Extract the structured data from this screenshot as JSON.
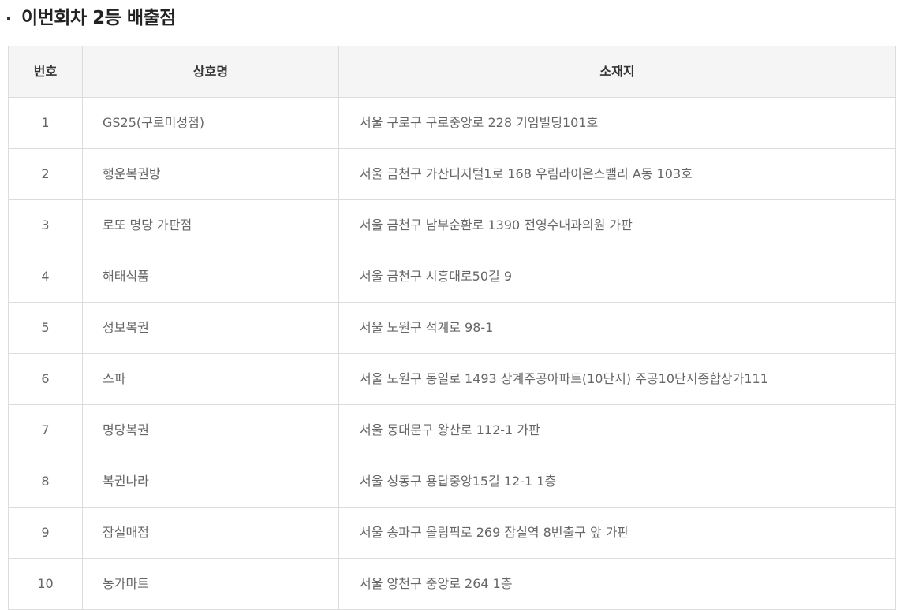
{
  "section": {
    "title": "이번회차 2등 배출점"
  },
  "table": {
    "headers": {
      "no": "번호",
      "name": "상호명",
      "address": "소재지"
    },
    "rows": [
      {
        "no": "1",
        "name": "GS25(구로미성점)",
        "address": "서울 구로구 구로중앙로 228 기임빌딩101호"
      },
      {
        "no": "2",
        "name": "행운복권방",
        "address": "서울 금천구 가산디지털1로 168 우림라이온스밸리 A동 103호"
      },
      {
        "no": "3",
        "name": "로또 명당 가판점",
        "address": "서울 금천구 남부순환로 1390 전영수내과의원 가판"
      },
      {
        "no": "4",
        "name": "해태식품",
        "address": "서울 금천구 시흥대로50길 9"
      },
      {
        "no": "5",
        "name": "성보복권",
        "address": "서울 노원구 석계로 98-1"
      },
      {
        "no": "6",
        "name": "스파",
        "address": "서울 노원구 동일로 1493 상계주공아파트(10단지) 주공10단지종합상가111"
      },
      {
        "no": "7",
        "name": "명당복권",
        "address": "서울 동대문구 왕산로 112-1 가판"
      },
      {
        "no": "8",
        "name": "복권나라",
        "address": "서울 성동구 용답중앙15길 12-1 1층"
      },
      {
        "no": "9",
        "name": "잠실매점",
        "address": "서울 송파구 올림픽로 269 잠실역 8번출구 앞 가판"
      },
      {
        "no": "10",
        "name": "농가마트",
        "address": "서울 양천구 중앙로 264 1층"
      }
    ]
  }
}
